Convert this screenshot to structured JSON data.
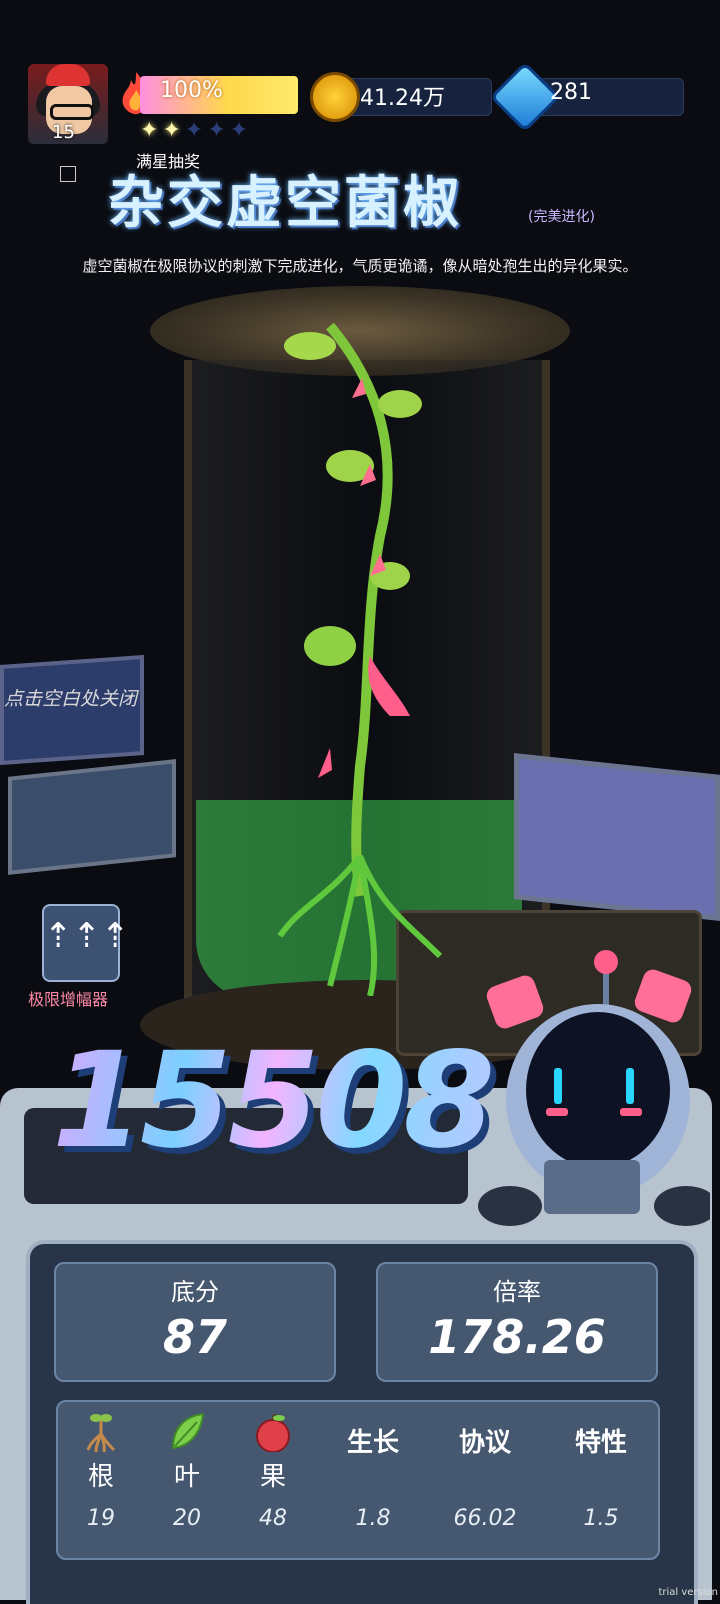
{
  "hud": {
    "level": "15",
    "energy_percent": "100%",
    "stars_filled": 2,
    "stars_total": 5,
    "coins": "41.24万",
    "gems": "281",
    "lottery_label": "满星抽奖"
  },
  "item": {
    "name": "杂交虚空菌椒",
    "tag": "(完美进化)",
    "description": "虚空菌椒在极限协议的刺激下完成进化，气质更诡谲，像从暗处孢生出的异化果实。"
  },
  "close_hint": "点击空白处关闭",
  "amplifier_label": "极限增幅器",
  "score": "15508",
  "base_score": {
    "label": "底分",
    "value": "87"
  },
  "multiplier": {
    "label": "倍率",
    "value": "178.26"
  },
  "stats": [
    {
      "name": "根",
      "value": "19",
      "icon": "root-icon"
    },
    {
      "name": "叶",
      "value": "20",
      "icon": "leaf-icon"
    },
    {
      "name": "果",
      "value": "48",
      "icon": "fruit-icon"
    },
    {
      "name": "生长",
      "value": "1.8"
    },
    {
      "name": "协议",
      "value": "66.02"
    },
    {
      "name": "特性",
      "value": "1.5"
    }
  ],
  "watermark": "trial version"
}
